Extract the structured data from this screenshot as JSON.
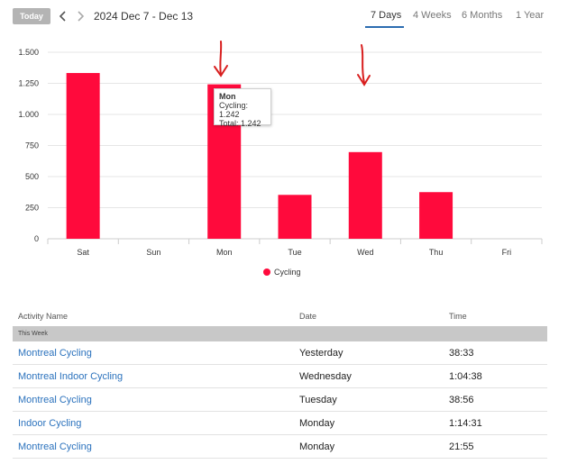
{
  "toolbar": {
    "today_label": "Today",
    "range_label": "2024 Dec 7 - Dec 13",
    "tabs": [
      {
        "label": "7 Days",
        "active": true
      },
      {
        "label": "4 Weeks",
        "active": false
      },
      {
        "label": "6 Months",
        "active": false
      },
      {
        "label": "1 Year",
        "active": false
      }
    ]
  },
  "colors": {
    "accent": "#ff0a3c",
    "link": "#2b72bd",
    "tab_underline": "#2b6cb0"
  },
  "chart_data": {
    "type": "bar",
    "categories": [
      "Sat",
      "Sun",
      "Mon",
      "Tue",
      "Wed",
      "Thu",
      "Fri"
    ],
    "series": [
      {
        "name": "Cycling",
        "values": [
          1333,
          0,
          1242,
          353,
          697,
          375,
          0
        ]
      }
    ],
    "ylim": [
      0,
      1500
    ],
    "yticks": [
      "0",
      "250",
      "500",
      "750",
      "1.000",
      "1.250",
      "1.500"
    ],
    "grid": true,
    "legend": "bottom-center"
  },
  "tooltip": {
    "title": "Mon",
    "line1": "Cycling: 1.242",
    "line2": "Total: 1.242"
  },
  "table": {
    "headers": {
      "name": "Activity Name",
      "date": "Date",
      "time": "Time"
    },
    "section": "This Week",
    "rows": [
      {
        "name": "Montreal Cycling",
        "date": "Yesterday",
        "time": "38:33"
      },
      {
        "name": "Montreal Indoor Cycling",
        "date": "Wednesday",
        "time": "1:04:38"
      },
      {
        "name": "Montreal Cycling",
        "date": "Tuesday",
        "time": "38:56"
      },
      {
        "name": "Indoor Cycling",
        "date": "Monday",
        "time": "1:14:31"
      },
      {
        "name": "Montreal Cycling",
        "date": "Monday",
        "time": "21:55"
      }
    ]
  }
}
